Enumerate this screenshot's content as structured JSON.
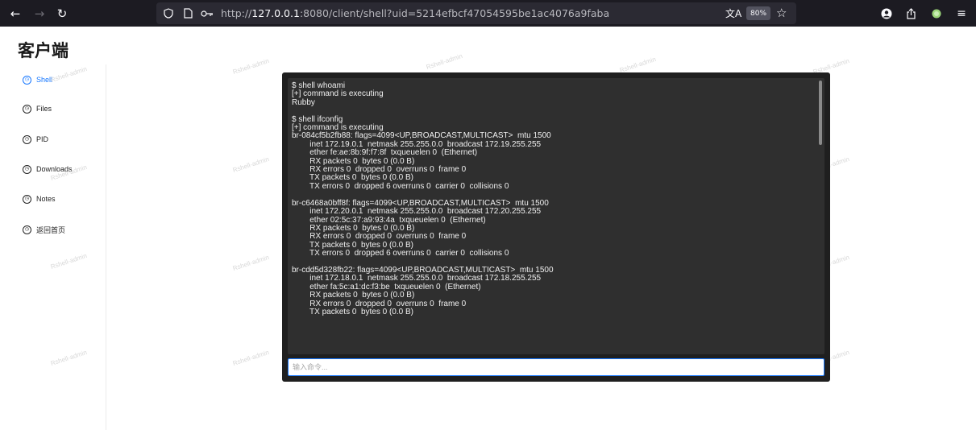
{
  "browser": {
    "url_prefix": "http://",
    "url_host": "127.0.0.1",
    "url_rest": ":8080/client/shell?uid=5214efbcf47054595be1ac4076a9faba",
    "zoom": "80%"
  },
  "page": {
    "title": "客户端",
    "watermark": "Rshell-admin"
  },
  "sidebar": {
    "items": [
      {
        "label": "Shell",
        "active": true
      },
      {
        "label": "Files",
        "active": false
      },
      {
        "label": "PID",
        "active": false
      },
      {
        "label": "Downloads",
        "active": false
      },
      {
        "label": "Notes",
        "active": false
      },
      {
        "label": "返回首页",
        "active": false
      }
    ]
  },
  "terminal": {
    "lines": [
      "$ shell whoami",
      "[+] command is executing",
      "Rubby",
      "",
      "$ shell ifconfig",
      "[+] command is executing",
      "br-084cf5b2fb88: flags=4099<UP,BROADCAST,MULTICAST>  mtu 1500",
      "        inet 172.19.0.1  netmask 255.255.0.0  broadcast 172.19.255.255",
      "        ether fe:ae:8b:9f:f7:8f  txqueuelen 0  (Ethernet)",
      "        RX packets 0  bytes 0 (0.0 B)",
      "        RX errors 0  dropped 0  overruns 0  frame 0",
      "        TX packets 0  bytes 0 (0.0 B)",
      "        TX errors 0  dropped 6 overruns 0  carrier 0  collisions 0",
      "",
      "br-c6468a0bff8f: flags=4099<UP,BROADCAST,MULTICAST>  mtu 1500",
      "        inet 172.20.0.1  netmask 255.255.0.0  broadcast 172.20.255.255",
      "        ether 02:5c:37:a9:93:4a  txqueuelen 0  (Ethernet)",
      "        RX packets 0  bytes 0 (0.0 B)",
      "        RX errors 0  dropped 0  overruns 0  frame 0",
      "        TX packets 0  bytes 0 (0.0 B)",
      "        TX errors 0  dropped 6 overruns 0  carrier 0  collisions 0",
      "",
      "br-cdd5d328fb22: flags=4099<UP,BROADCAST,MULTICAST>  mtu 1500",
      "        inet 172.18.0.1  netmask 255.255.0.0  broadcast 172.18.255.255",
      "        ether fa:5c:a1:dc:f3:be  txqueuelen 0  (Ethernet)",
      "        RX packets 0  bytes 0 (0.0 B)",
      "        RX errors 0  dropped 0  overruns 0  frame 0",
      "        TX packets 0  bytes 0 (0.0 B)"
    ],
    "input_placeholder": "输入命令..."
  }
}
